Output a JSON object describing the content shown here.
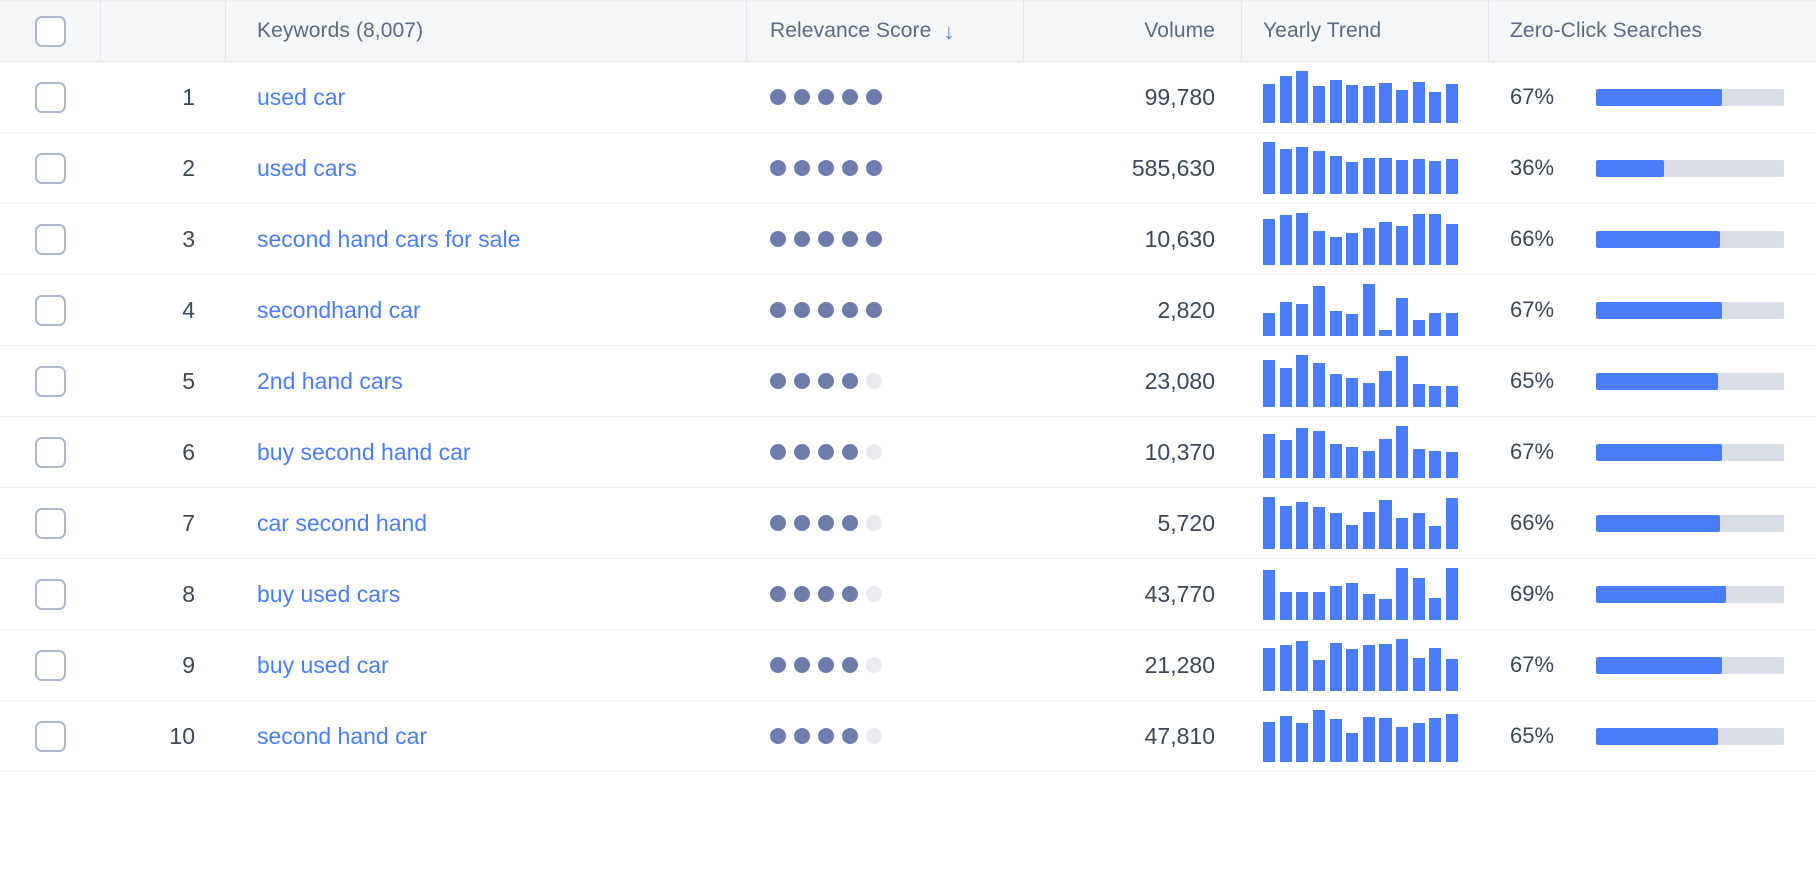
{
  "colors": {
    "accent": "#4a7dfc",
    "dot_filled": "#6f7cab",
    "dot_empty": "#e9ebf0",
    "track": "#d9dde6",
    "header_bg": "#f6f7f9",
    "text": "#3c4858",
    "header_text": "#5b6b84",
    "checkbox_border": "#aeb8cc"
  },
  "table": {
    "columns": [
      {
        "key": "select",
        "label": "",
        "icon": "checkbox-icon"
      },
      {
        "key": "rank",
        "label": ""
      },
      {
        "key": "keywords",
        "label": "Keywords (8,007)"
      },
      {
        "key": "relevance",
        "label": "Relevance Score",
        "sort": "desc",
        "sort_icon": "arrow-down-icon"
      },
      {
        "key": "volume",
        "label": "Volume"
      },
      {
        "key": "trend",
        "label": "Yearly Trend"
      },
      {
        "key": "zeroclick",
        "label": "Zero-Click Searches"
      }
    ],
    "keyword_count": "8,007",
    "rows": [
      {
        "rank": "1",
        "keyword": "used car",
        "relevance_filled": 5,
        "relevance_total": 5,
        "volume": "99,780",
        "zero_click_label": "67%",
        "zero_click_value": 67,
        "trend": [
          66,
          80,
          88,
          62,
          72,
          64,
          63,
          68,
          56,
          69,
          52,
          66
        ]
      },
      {
        "rank": "2",
        "keyword": "used cars",
        "relevance_filled": 5,
        "relevance_total": 5,
        "volume": "585,630",
        "zero_click_label": "36%",
        "zero_click_value": 36,
        "trend": [
          100,
          86,
          90,
          82,
          74,
          62,
          70,
          69,
          66,
          68,
          63,
          68
        ]
      },
      {
        "rank": "3",
        "keyword": "second hand cars for sale",
        "relevance_filled": 5,
        "relevance_total": 5,
        "volume": "10,630",
        "zero_click_label": "66%",
        "zero_click_value": 66,
        "trend": [
          78,
          84,
          88,
          58,
          48,
          54,
          62,
          72,
          66,
          86,
          86,
          70
        ]
      },
      {
        "rank": "4",
        "keyword": "secondhand car",
        "relevance_filled": 5,
        "relevance_total": 5,
        "volume": "2,820",
        "zero_click_label": "67%",
        "zero_click_value": 67,
        "trend": [
          43,
          62,
          60,
          92,
          46,
          40,
          96,
          12,
          70,
          30,
          42,
          42
        ]
      },
      {
        "rank": "5",
        "keyword": "2nd hand cars",
        "relevance_filled": 4,
        "relevance_total": 5,
        "volume": "23,080",
        "zero_click_label": "65%",
        "zero_click_value": 65,
        "trend": [
          82,
          68,
          90,
          76,
          58,
          50,
          42,
          62,
          88,
          40,
          36,
          36
        ]
      },
      {
        "rank": "6",
        "keyword": "buy second hand car",
        "relevance_filled": 4,
        "relevance_total": 5,
        "volume": "10,370",
        "zero_click_label": "67%",
        "zero_click_value": 67,
        "trend": [
          82,
          70,
          92,
          86,
          62,
          58,
          50,
          72,
          96,
          54,
          50,
          48
        ]
      },
      {
        "rank": "7",
        "keyword": "car second hand",
        "relevance_filled": 4,
        "relevance_total": 5,
        "volume": "5,720",
        "zero_click_label": "66%",
        "zero_click_value": 66,
        "trend": [
          98,
          82,
          88,
          80,
          68,
          46,
          70,
          92,
          58,
          68,
          44,
          96
        ]
      },
      {
        "rank": "8",
        "keyword": "buy used cars",
        "relevance_filled": 4,
        "relevance_total": 5,
        "volume": "43,770",
        "zero_click_label": "69%",
        "zero_click_value": 69,
        "trend": [
          92,
          52,
          52,
          52,
          62,
          68,
          48,
          38,
          96,
          78,
          40,
          96
        ]
      },
      {
        "rank": "9",
        "keyword": "buy used car",
        "relevance_filled": 4,
        "relevance_total": 5,
        "volume": "21,280",
        "zero_click_label": "67%",
        "zero_click_value": 67,
        "trend": [
          70,
          74,
          80,
          50,
          78,
          68,
          74,
          76,
          84,
          54,
          70,
          52
        ]
      },
      {
        "rank": "10",
        "keyword": "second hand car",
        "relevance_filled": 4,
        "relevance_total": 5,
        "volume": "47,810",
        "zero_click_label": "65%",
        "zero_click_value": 65,
        "trend": [
          72,
          84,
          70,
          94,
          78,
          52,
          82,
          80,
          64,
          70,
          80,
          86
        ]
      }
    ]
  }
}
